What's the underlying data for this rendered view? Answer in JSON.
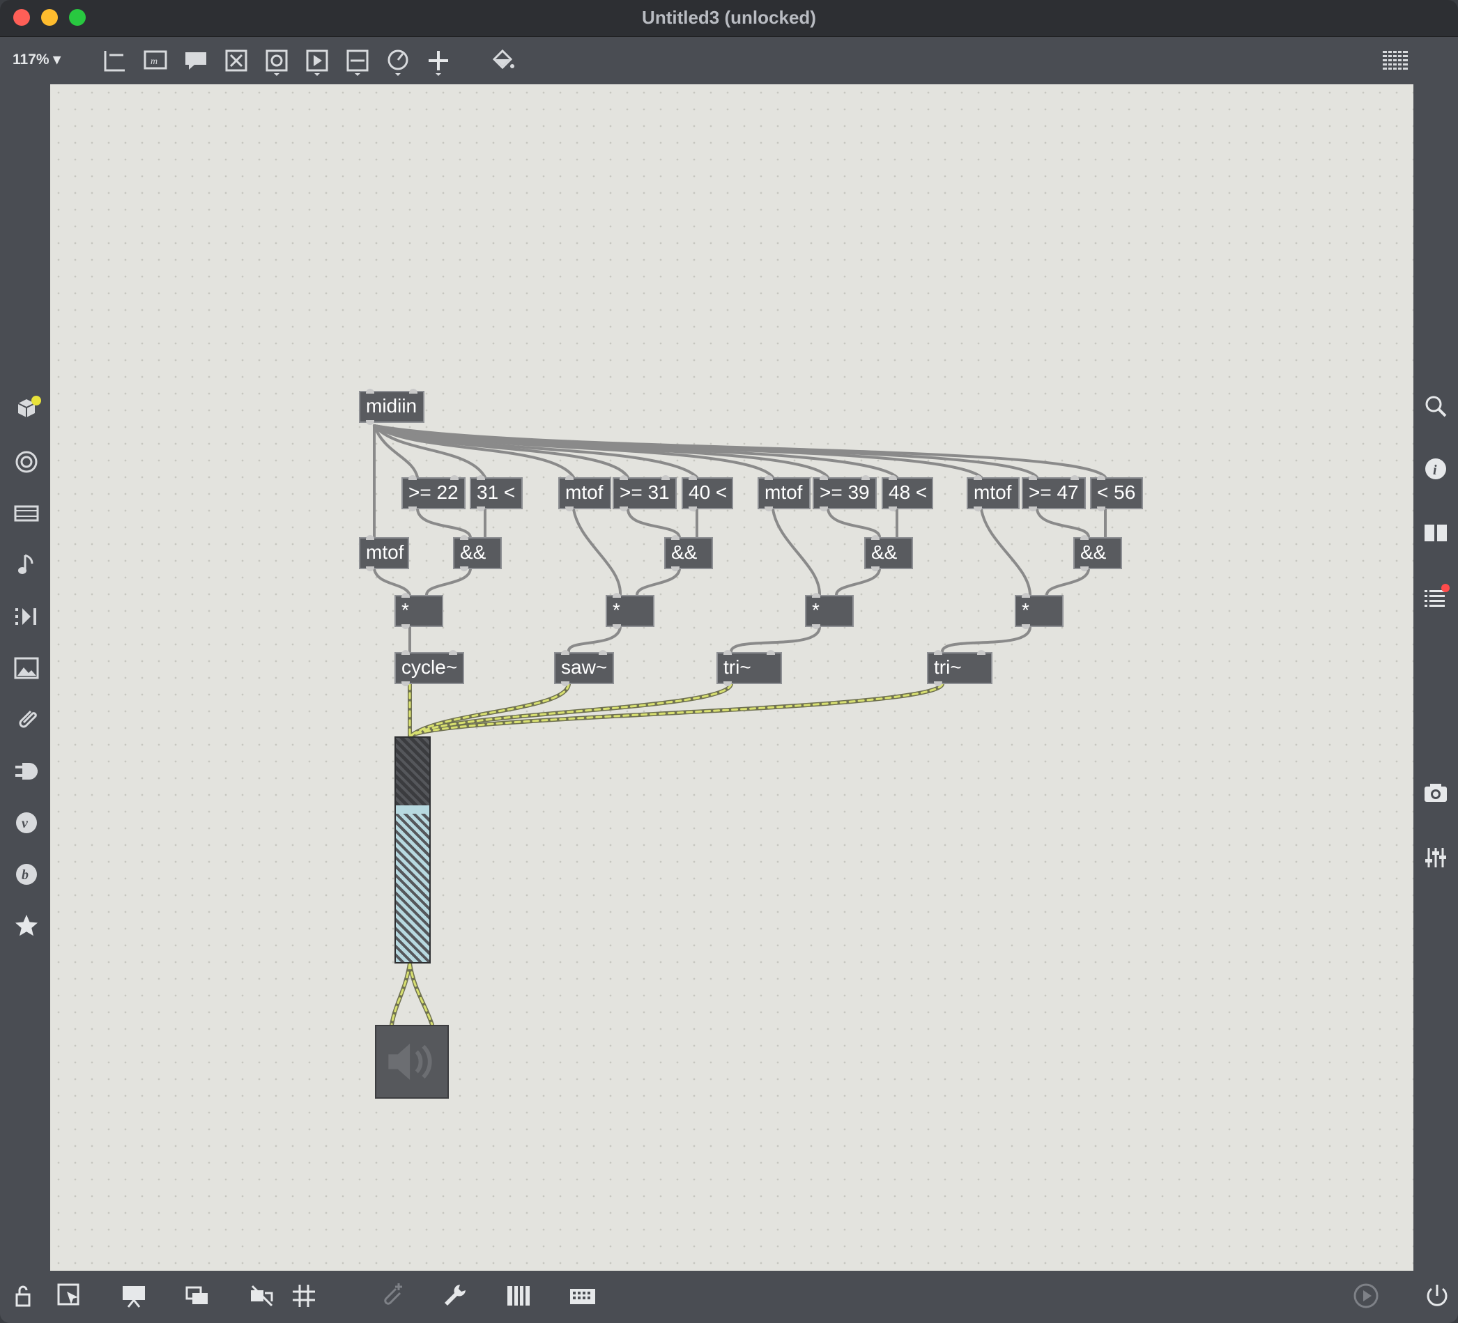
{
  "window": {
    "title": "Untitled3 (unlocked)"
  },
  "toolbar": {
    "zoom": "117% ▾",
    "icons": [
      "new-object-icon",
      "message-icon",
      "comment-icon",
      "toggle-icon",
      "button-icon",
      "playbar-icon",
      "slider-icon",
      "dial-icon",
      "add-icon",
      "format-paint-icon",
      "grid-toggle-icon"
    ]
  },
  "sidebar_left": {
    "icons": [
      "package-manager-icon",
      "browse-icon",
      "media-icon",
      "music-icon",
      "playlist-icon",
      "image-icon",
      "snippets-icon",
      "plugin-icon",
      "vst-icon",
      "bpatcher-icon",
      "favorites-icon"
    ]
  },
  "sidebar_right": {
    "icons": [
      "search-icon",
      "inspector-icon",
      "reference-icon",
      "console-icon",
      "snapshot-icon",
      "mixer-icon"
    ]
  },
  "bottombar": {
    "icons": [
      "lock-icon",
      "select-icon",
      "presentation-icon",
      "layers-icon",
      "hide-icon",
      "grid-icon",
      "add-clip-icon",
      "wrench-icon",
      "piano-icon",
      "keyboard-icon",
      "audio-status-icon",
      "power-icon"
    ]
  },
  "patch": {
    "objects": [
      {
        "id": "midiin",
        "text": "midiin"
      },
      {
        "id": "ge22",
        "text": ">= 22"
      },
      {
        "id": "lt31",
        "text": "31 <"
      },
      {
        "id": "mtof1",
        "text": "mtof"
      },
      {
        "id": "and1",
        "text": "&&"
      },
      {
        "id": "mul1",
        "text": "*"
      },
      {
        "id": "cycle",
        "text": "cycle~"
      },
      {
        "id": "mtof2",
        "text": "mtof"
      },
      {
        "id": "ge31",
        "text": ">= 31"
      },
      {
        "id": "lt40",
        "text": "40 <"
      },
      {
        "id": "and2",
        "text": "&&"
      },
      {
        "id": "mul2",
        "text": "*"
      },
      {
        "id": "saw",
        "text": "saw~"
      },
      {
        "id": "mtof3",
        "text": "mtof"
      },
      {
        "id": "ge39",
        "text": ">= 39"
      },
      {
        "id": "lt48",
        "text": "48 <"
      },
      {
        "id": "and3",
        "text": "&&"
      },
      {
        "id": "mul3",
        "text": "*"
      },
      {
        "id": "tri1",
        "text": "tri~"
      },
      {
        "id": "mtof4",
        "text": "mtof"
      },
      {
        "id": "ge47",
        "text": ">= 47"
      },
      {
        "id": "lt56",
        "text": "< 56"
      },
      {
        "id": "and4",
        "text": "&&"
      },
      {
        "id": "mul4",
        "text": "*"
      },
      {
        "id": "tri2",
        "text": "tri~"
      }
    ],
    "gain_level": 0.7
  },
  "colors": {
    "canvas": "#e3e3de",
    "object": "#595b5f",
    "signal_wire": "#d8e070",
    "wire": "#8a8a8a",
    "accent_blue": "#b7d9e0"
  }
}
